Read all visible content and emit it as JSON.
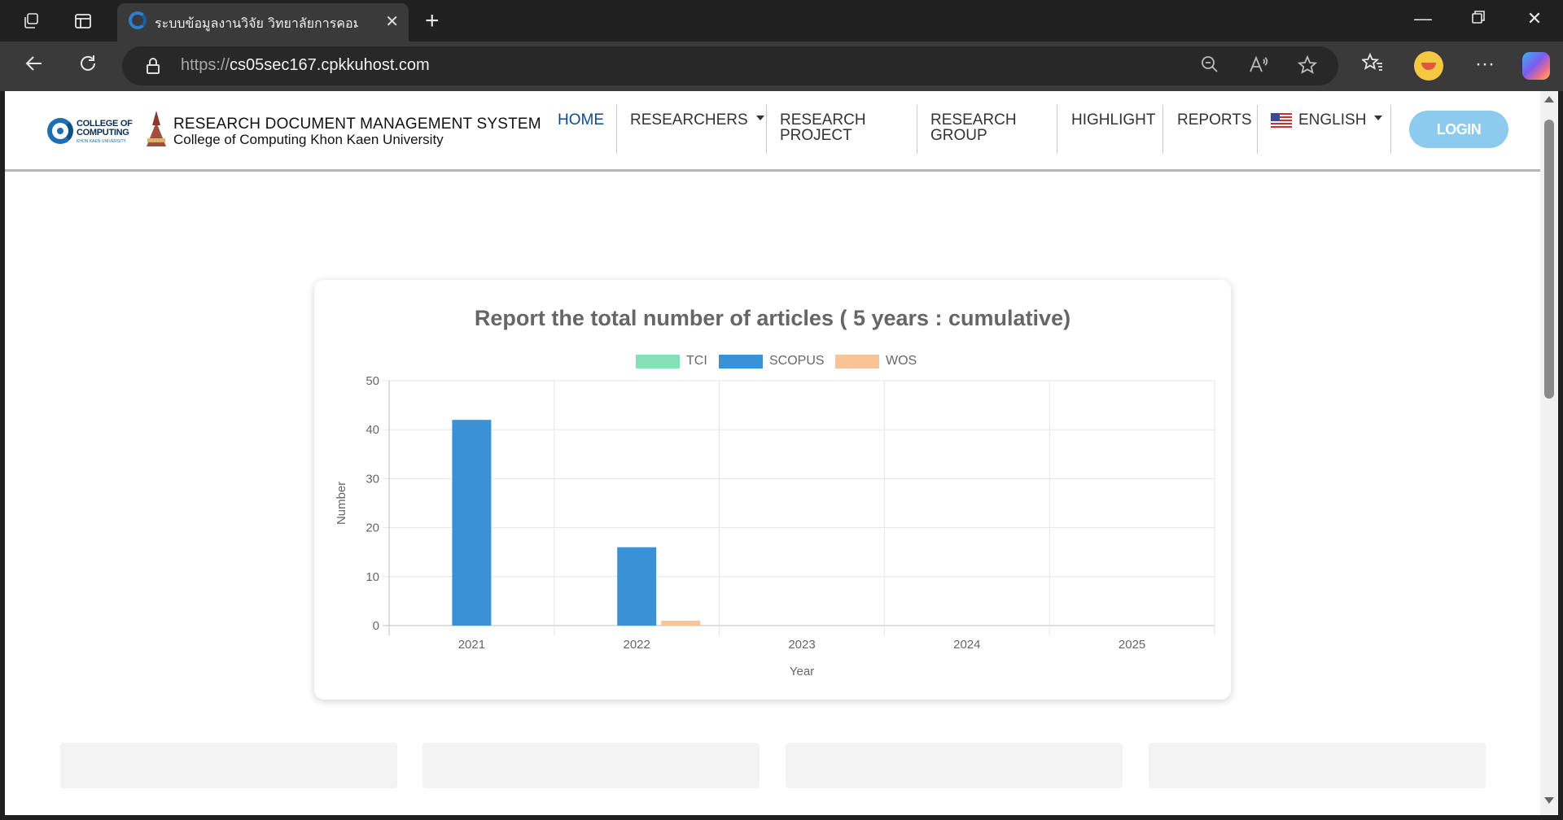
{
  "browser": {
    "tab_title": "ระบบข้อมูลงานวิจัย วิทยาลัยการคอมพิวเตอร์",
    "url_scheme": "https://",
    "url_host": "cs05sec167.cpkkuhost.com"
  },
  "site": {
    "title": "RESEARCH DOCUMENT MANAGEMENT SYSTEM",
    "subtitle": "College of Computing Khon Kaen University",
    "logo_text_line1": "COLLEGE OF",
    "logo_text_line2": "COMPUTING",
    "logo_text_line3": "KHON KAEN UNIVERSITY"
  },
  "nav": {
    "home": "HOME",
    "researchers": "RESEARCHERS",
    "research_project_1": "RESEARCH",
    "research_project_2": "PROJECT",
    "research_group_1": "RESEARCH",
    "research_group_2": "GROUP",
    "highlight": "HIGHLIGHT",
    "reports": "REPORTS",
    "language": "ENGLISH",
    "login": "LOGIN"
  },
  "chart_data": {
    "type": "bar",
    "title": "Report the total number of articles ( 5 years : cumulative)",
    "xlabel": "Year",
    "ylabel": "Number",
    "categories": [
      "2021",
      "2022",
      "2023",
      "2024",
      "2025"
    ],
    "series": [
      {
        "name": "TCI",
        "values": [
          0,
          0,
          0,
          0,
          0
        ],
        "color": "#86e0b7"
      },
      {
        "name": "SCOPUS",
        "values": [
          42,
          16,
          0,
          0,
          0
        ],
        "color": "#3b91d6"
      },
      {
        "name": "WOS",
        "values": [
          0,
          1,
          0,
          0,
          0
        ],
        "color": "#f8c396"
      }
    ],
    "ylim": [
      0,
      50
    ],
    "yticks": [
      0,
      10,
      20,
      30,
      40,
      50
    ],
    "grid": true,
    "legend_position": "top"
  }
}
